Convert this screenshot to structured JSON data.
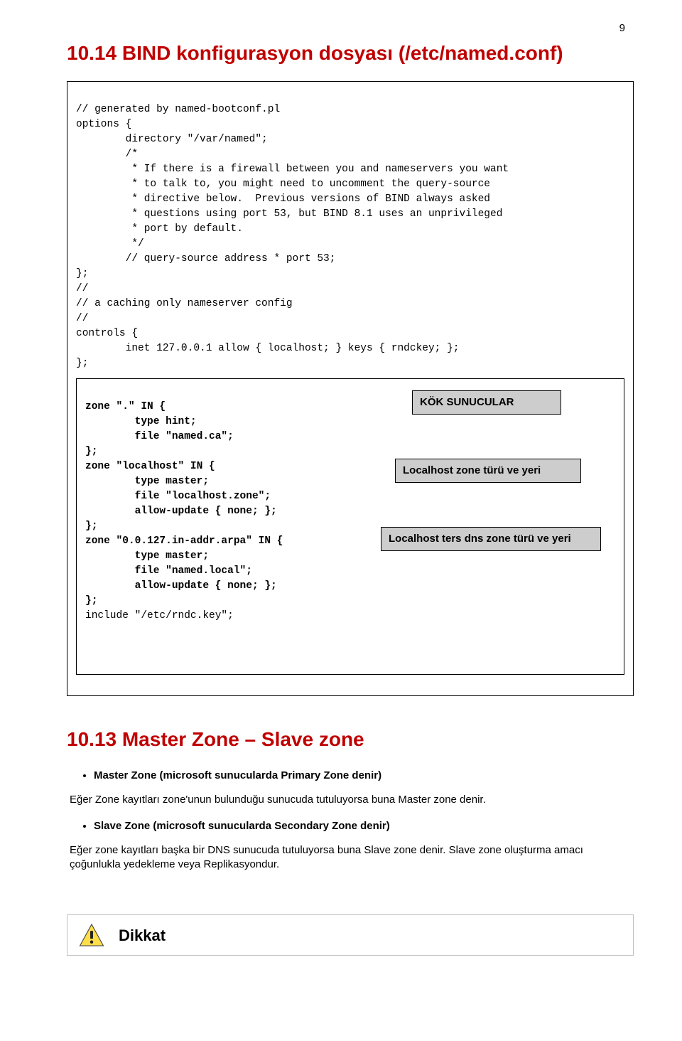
{
  "page_number": "9",
  "heading1": "10.14 BIND konfigurasyon dosyası (/etc/named.conf)",
  "code_top": "// generated by named-bootconf.pl\noptions {\n        directory \"/var/named\";\n        /*\n         * If there is a firewall between you and nameservers you want\n         * to talk to, you might need to uncomment the query-source\n         * directive below.  Previous versions of BIND always asked\n         * questions using port 53, but BIND 8.1 uses an unprivileged\n         * port by default.\n         */\n        // query-source address * port 53;\n};\n//\n// a caching only nameserver config\n//\ncontrols {\n        inet 127.0.0.1 allow { localhost; } keys { rndckey; };\n};",
  "code_inner": "<b>zone \".\" IN {\n        type hint;\n        file \"named.ca\";\n};\nzone \"localhost\" IN {\n        type master;\n        file \"localhost.zone\";\n        allow-update { none; };\n};\nzone \"0.0.127.in-addr.arpa\" IN {\n        type master;\n        file \"named.local\";\n        allow-update { none; };\n};</b>\ninclude \"/etc/rndc.key\";",
  "callouts": {
    "c1": "KÖK SUNUCULAR",
    "c2": "Localhost zone türü ve yeri",
    "c3": "Localhost ters dns zone türü ve yeri"
  },
  "heading2": "10.13 Master Zone – Slave zone",
  "bullet1": "Master Zone (microsoft sunucularda Primary Zone denir)",
  "para1": "Eğer Zone kayıtları zone'unun bulunduğu sunucuda tutuluyorsa buna Master zone denir.",
  "bullet2": "Slave Zone (microsoft sunucularda Secondary Zone denir)",
  "para2": "Eğer zone kayıtları başka bir DNS sunucuda tutuluyorsa buna Slave zone denir. Slave zone oluşturma amacı çoğunlukla yedekleme veya Replikasyondur.",
  "dikkat_label": "Dikkat"
}
